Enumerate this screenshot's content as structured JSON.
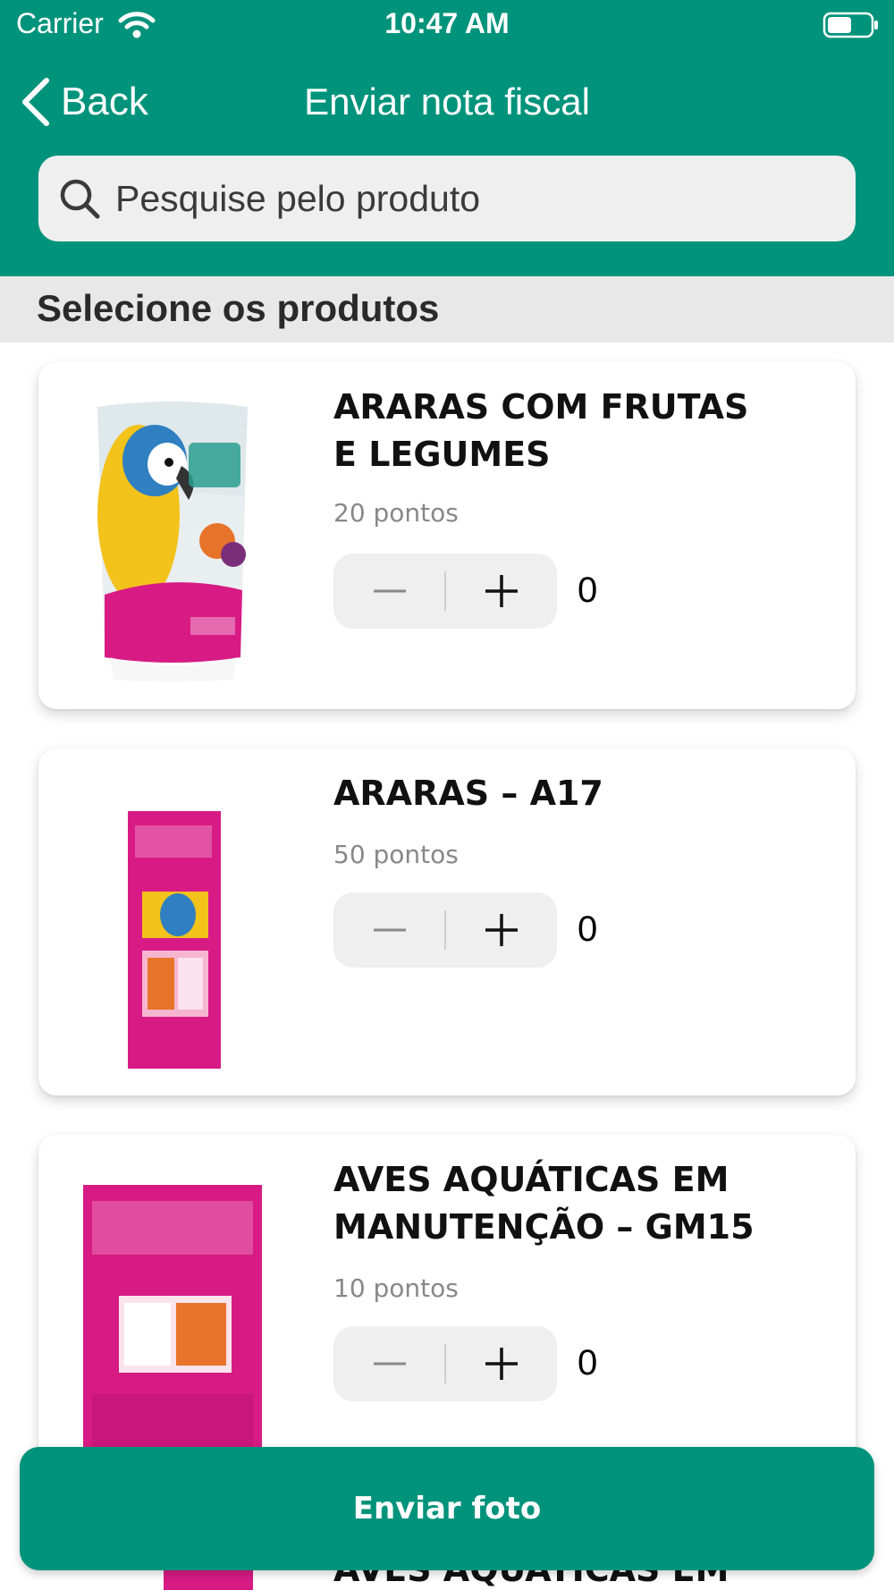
{
  "status_bar": {
    "carrier": "Carrier",
    "time": "10:47 AM"
  },
  "nav": {
    "back_label": "Back",
    "title": "Enviar nota fiscal"
  },
  "search": {
    "placeholder": "Pesquise pelo produto"
  },
  "section": {
    "title": "Selecione os produtos"
  },
  "products": [
    {
      "name_line1": "ARARAS COM FRUTAS",
      "name_line2": "E LEGUMES",
      "points": "20 pontos",
      "quantity": "0",
      "image": "megazoo-araras-frutas-package"
    },
    {
      "name_line1": "ARARAS – A17",
      "name_line2": "",
      "points": "50 pontos",
      "quantity": "0",
      "image": "megazoo-araras-a17-bag"
    },
    {
      "name_line1": "AVES AQUÁTICAS EM",
      "name_line2": "MANUTENÇÃO – GM15",
      "points": "10 pontos",
      "quantity": "0",
      "image": "megazoo-aves-aquaticas-bag"
    },
    {
      "name_line1": "AVES AQUÁTICAS EM"
    }
  ],
  "bottom_button": {
    "label": "Enviar foto"
  },
  "colors": {
    "brand": "#00937b",
    "section_bg": "#e8e8e8",
    "stepper_bg": "#efefef",
    "product_pink": "#d81b84"
  },
  "icons": [
    "wifi-icon",
    "battery-icon",
    "back-chevron-icon",
    "search-icon",
    "minus-icon",
    "plus-icon"
  ]
}
